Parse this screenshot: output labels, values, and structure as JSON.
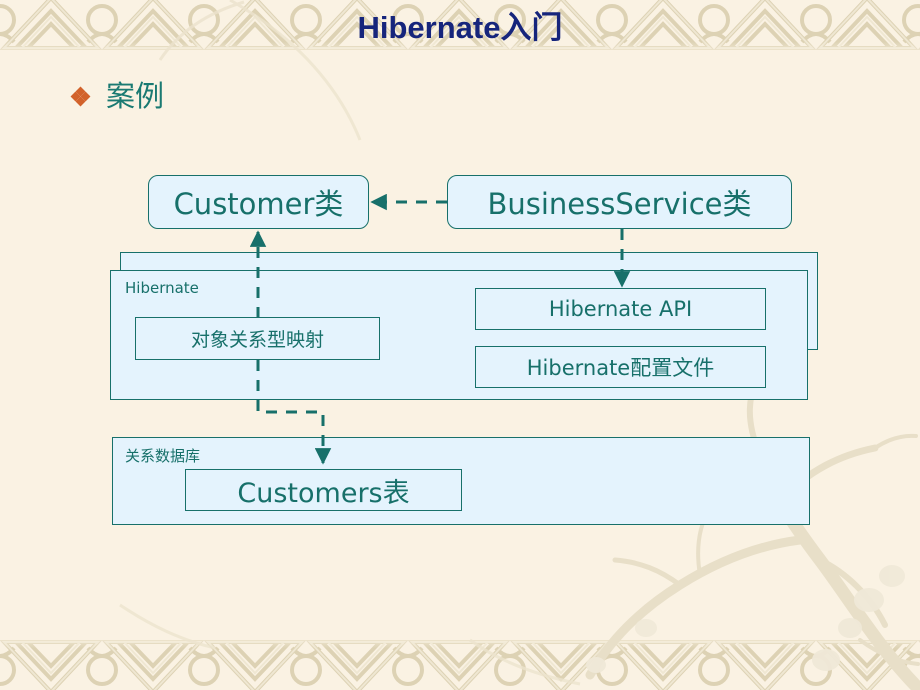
{
  "slide": {
    "title": "Hibernate入门",
    "title_color": "#16257c",
    "background_color": "#faf2e3",
    "accent_color": "#17706a",
    "bullet_color": "#d2622a",
    "node_fill": "#e4f3fd"
  },
  "bullet": {
    "marker": "diamond-cluster-bullet",
    "text": "案例"
  },
  "diagram": {
    "nodes": {
      "customer_class": "Customer类",
      "business_service_class": "BusinessService类",
      "hibernate_label": "Hibernate",
      "orm": "对象关系型映射",
      "hibernate_api": "Hibernate API",
      "hibernate_config": "Hibernate配置文件",
      "database_label": "关系数据库",
      "customers_table": "Customers表"
    },
    "connectors": [
      {
        "name": "businessservice-to-customer",
        "from": "business_service_class",
        "to": "customer_class",
        "style": "dashed",
        "arrow": "left"
      },
      {
        "name": "businessservice-to-hibernate-api",
        "from": "business_service_class",
        "to": "hibernate_api",
        "style": "dashed",
        "arrow": "down"
      },
      {
        "name": "orm-to-customer",
        "from": "orm",
        "to": "customer_class",
        "style": "dashed",
        "arrow": "up"
      },
      {
        "name": "orm-to-customers-table",
        "from": "orm",
        "to": "customers_table",
        "style": "dashed",
        "arrow": "down"
      }
    ]
  }
}
